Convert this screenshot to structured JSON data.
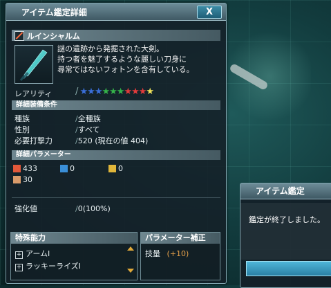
{
  "window": {
    "title": "アイテム鑑定詳細",
    "close_label": "X"
  },
  "item": {
    "name": "ルインシャルム",
    "description": [
      "謎の遺跡から発掘された大剣。",
      "持つ者を魅了するような麗しい刀身に",
      "尋常ではないフォトンを含有している。"
    ],
    "rarity_label": "レアリティ",
    "rarity_stars": [
      "#3a6ed8",
      "#3a6ed8",
      "#3a6ed8",
      "#35b24a",
      "#35b24a",
      "#35b24a",
      "#e23b3b",
      "#e23b3b",
      "#e23b3b",
      "#f2e35a"
    ]
  },
  "requirements": {
    "header": "詳細装備条件",
    "rows": [
      {
        "label": "種族",
        "value": "全種族"
      },
      {
        "label": "性別",
        "value": "すべて"
      },
      {
        "label": "必要打撃力",
        "value": "520 (現在の値 404)"
      }
    ]
  },
  "parameters": {
    "header": "詳細パラメーター",
    "attack": "433",
    "ranged": "0",
    "tech": "0",
    "defense": "30",
    "icon_colors": {
      "attack": "#e0583a",
      "ranged": "#3a8fd8",
      "tech": "#e0b63a",
      "defense": "#d89a6a"
    }
  },
  "enhance": {
    "label": "強化値",
    "value": "0(100%)"
  },
  "abilities": {
    "header": "特殊能力",
    "items": [
      "アームI",
      "ラッキーライズI"
    ]
  },
  "param_bonus": {
    "header": "パラメーター補正",
    "stat": "技量",
    "value": "(+10)"
  },
  "dialog": {
    "title": "アイテム鑑定",
    "message": "鑑定が終了しました。"
  }
}
